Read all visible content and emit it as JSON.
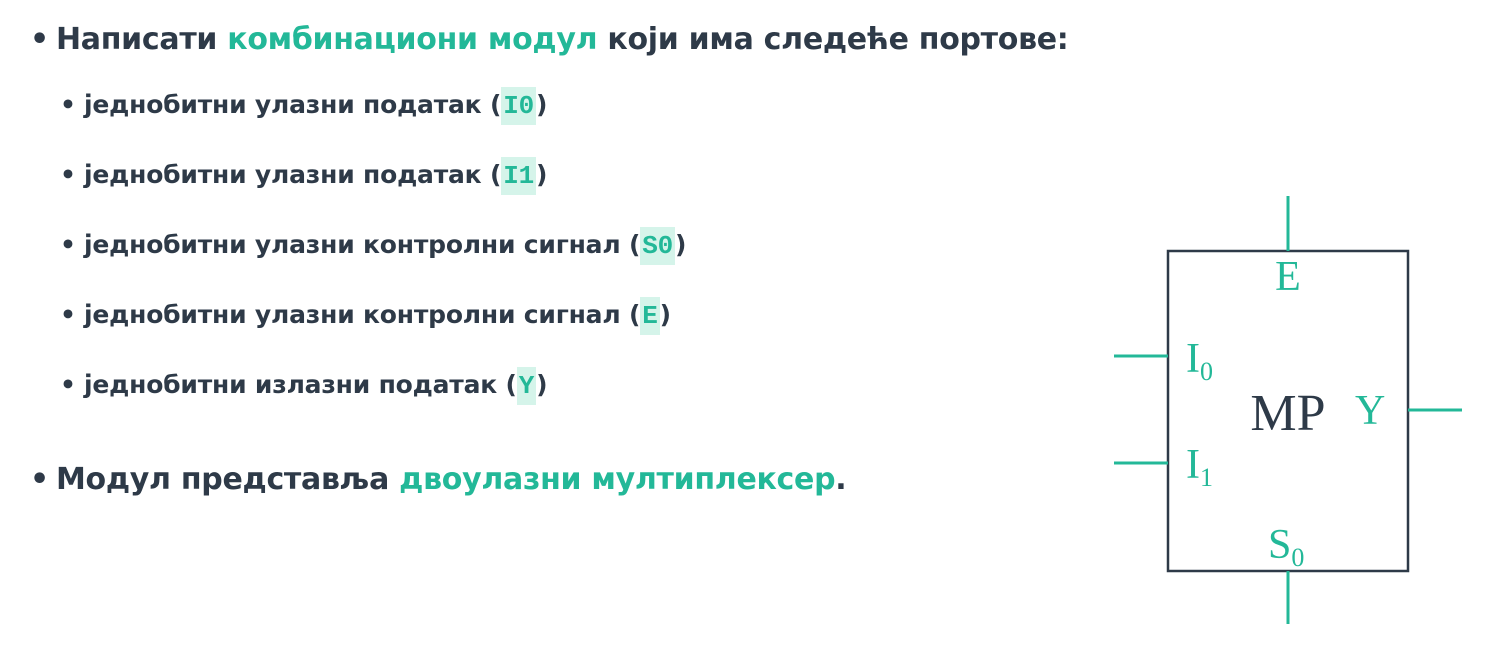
{
  "content": {
    "line1": {
      "bullet": "•",
      "prefix": "Написати ",
      "highlight": "комбинациони модул",
      "suffix": " који има следеће портове:"
    },
    "ports": [
      {
        "bullet": "•",
        "text": "једнобитни улазни податак (",
        "code": "I0",
        "close": ")"
      },
      {
        "bullet": "•",
        "text": "једнобитни улазни податак (",
        "code": "I1",
        "close": ")"
      },
      {
        "bullet": "•",
        "text": "једнобитни улазни контролни сигнал (",
        "code": "S0",
        "close": ")"
      },
      {
        "bullet": "•",
        "text": "једнобитни улазни контролни сигнал (",
        "code": "E",
        "close": ")"
      },
      {
        "bullet": "•",
        "text": "једнобитни излазни податак (",
        "code": "Y",
        "close": ")"
      }
    ],
    "line2": {
      "bullet": "•",
      "prefix": "Модул представља ",
      "highlight": "двоулазни мултиплексер",
      "suffix": "."
    }
  },
  "diagram": {
    "block_label": "MP",
    "enable_label": "E",
    "input0_label": "I",
    "input0_sub": "0",
    "input1_label": "I",
    "input1_sub": "1",
    "select_label": "S",
    "select_sub": "0",
    "output_label": "Y"
  },
  "colors": {
    "accent": "#23b898",
    "text": "#2e3a48",
    "code_background": "#d5f4ea",
    "block_border": "#2e3a48"
  }
}
